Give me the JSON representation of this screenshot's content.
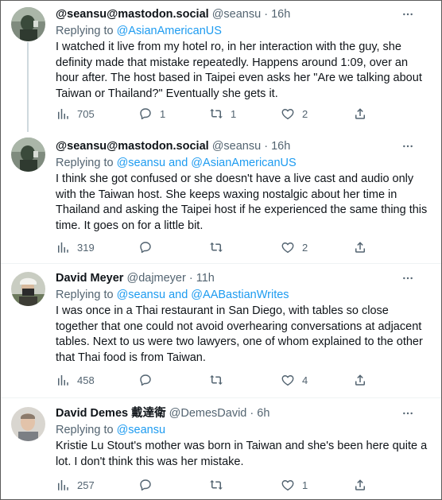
{
  "tweets": [
    {
      "name": "@seansu@mastodon.social",
      "handle": "@seansu",
      "dot": "·",
      "time": "16h",
      "reply_prefix": "Replying to ",
      "reply_to": "@AsianAmericanUS",
      "text": "I watched it live from my hotel ro, in her interaction with the guy, she definity made that mistake repeatedly. Happens around 1:09, over an hour after. The host based in Taipei even asks her \"Are we talking about Taiwan or Thailand?\" Eventually she gets it.",
      "views": "705",
      "replies": "1",
      "retweets": "1",
      "likes": "2"
    },
    {
      "name": "@seansu@mastodon.social",
      "handle": "@seansu",
      "dot": "·",
      "time": "16h",
      "reply_prefix": "Replying to ",
      "reply_to": "@seansu and @AsianAmericanUS",
      "text": "I think she got confused or she doesn't have a live cast and audio only with the Taiwan host. She keeps waxing nostalgic about her time in Thailand and asking the Taipei host if he experienced the same thing this time. It goes on for a little bit.",
      "views": "319",
      "replies": "",
      "retweets": "",
      "likes": "2"
    },
    {
      "name": "David Meyer",
      "handle": "@dajmeyer",
      "dot": "·",
      "time": "11h",
      "reply_prefix": "Replying to ",
      "reply_to": "@seansu and @AABastianWrites",
      "text": "I was once in a Thai restaurant in San Diego, with tables so close together that one could not avoid overhearing conversations at adjacent tables. Next to us were two lawyers, one of whom explained to the other that Thai food is from Taiwan.",
      "views": "458",
      "replies": "",
      "retweets": "",
      "likes": "4"
    },
    {
      "name": "David Demes 戴達衛",
      "handle": "@DemesDavid",
      "dot": "·",
      "time": "6h",
      "reply_prefix": "Replying to ",
      "reply_to": "@seansu",
      "text": "Kristie Lu Stout's mother was born in Taiwan and she's been here quite a lot. I don't think this was her mistake.",
      "views": "257",
      "replies": "",
      "retweets": "",
      "likes": "1"
    }
  ],
  "icons": {
    "views": "analytics-icon",
    "reply": "reply-bubble-icon",
    "retweet": "retweet-icon",
    "like": "heart-icon",
    "share": "share-icon",
    "more": "more-dots-icon"
  },
  "colors": {
    "text": "#0f1419",
    "muted": "#536471",
    "link": "#1d9bf0",
    "separator": "#eff3f4"
  }
}
